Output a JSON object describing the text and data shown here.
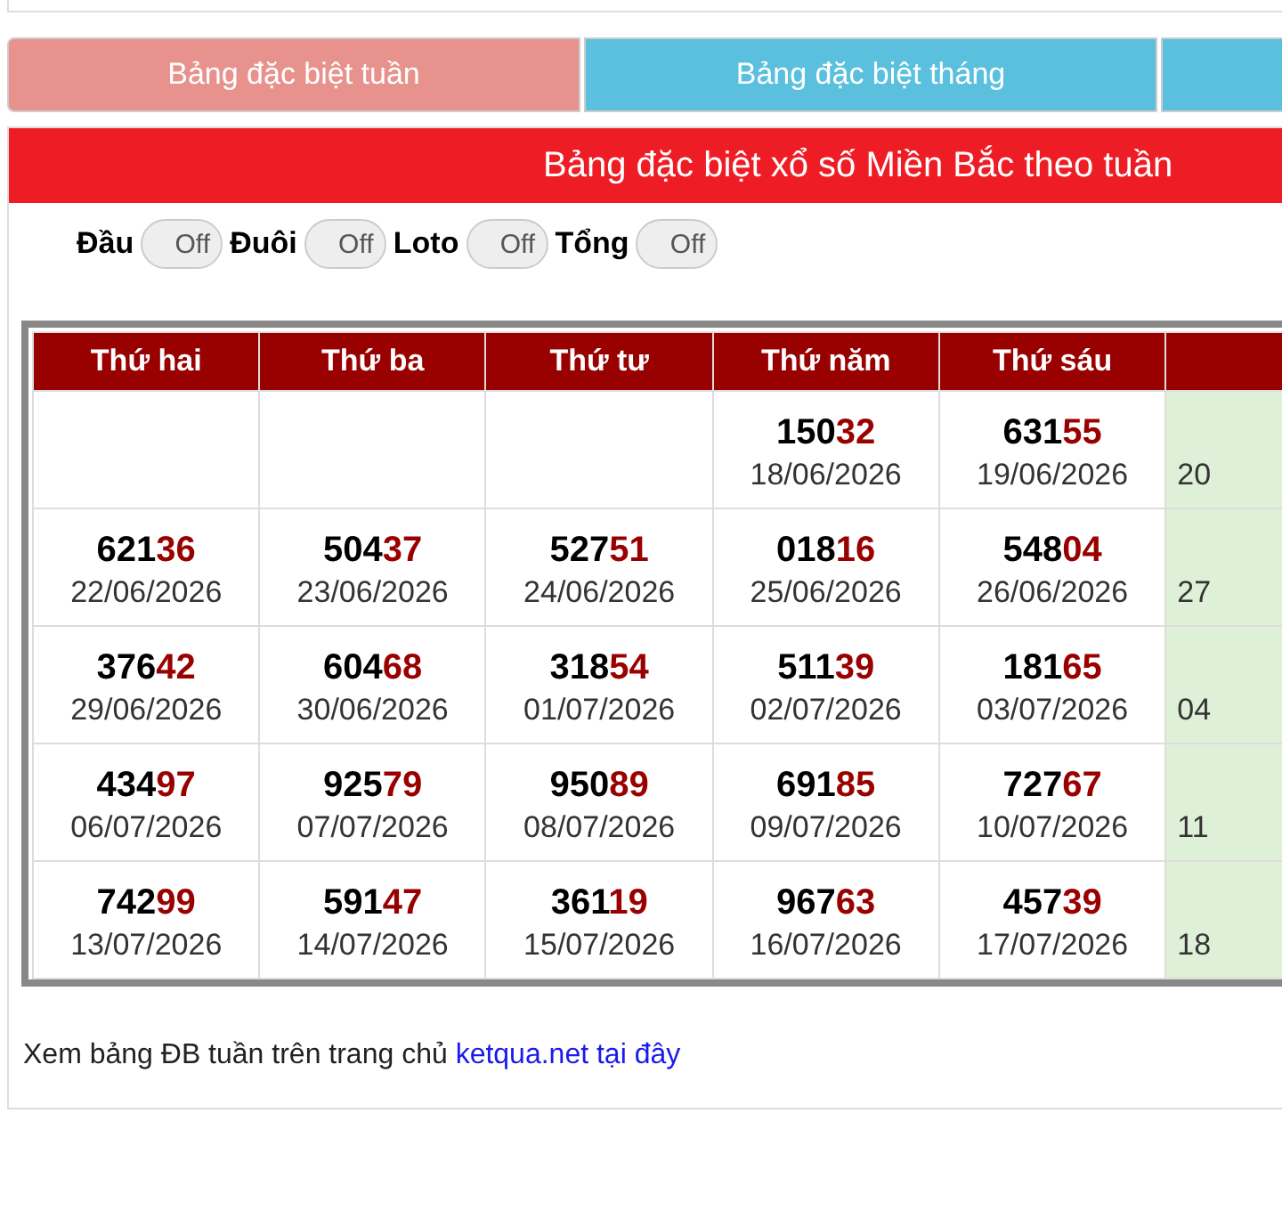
{
  "tabs": [
    {
      "label": "Bảng đặc biệt tuần",
      "selected": true
    },
    {
      "label": "Bảng đặc biệt tháng",
      "selected": false
    },
    {
      "selected": false
    }
  ],
  "title": "Bảng đặc biệt xổ số Miền Bắc theo tuần",
  "toggles": [
    {
      "label": "Đầu",
      "state": "Off",
      "on": false
    },
    {
      "label": "Đuôi",
      "state": "Off",
      "on": false
    },
    {
      "label": "Loto",
      "state": "Off",
      "on": false
    },
    {
      "label": "Tổng",
      "state": "Off",
      "on": false
    }
  ],
  "table": {
    "columns": [
      "Thứ hai",
      "Thứ ba",
      "Thứ tư",
      "Thứ năm",
      "Thứ sáu"
    ],
    "rows": [
      [
        {},
        {},
        {},
        {
          "number": "15032",
          "date": "18/06/2026"
        },
        {
          "number": "63155",
          "date": "19/06/2026"
        },
        {
          "date": "20"
        }
      ],
      [
        {
          "number": "62136",
          "date": "22/06/2026"
        },
        {
          "number": "50437",
          "date": "23/06/2026"
        },
        {
          "number": "52751",
          "date": "24/06/2026"
        },
        {
          "number": "01816",
          "date": "25/06/2026"
        },
        {
          "number": "54804",
          "date": "26/06/2026"
        },
        {
          "date": "27"
        }
      ],
      [
        {
          "number": "37642",
          "date": "29/06/2026"
        },
        {
          "number": "60468",
          "date": "30/06/2026"
        },
        {
          "number": "31854",
          "date": "01/07/2026"
        },
        {
          "number": "51139",
          "date": "02/07/2026"
        },
        {
          "number": "18165",
          "date": "03/07/2026"
        },
        {
          "date": "04"
        }
      ],
      [
        {
          "number": "43497",
          "date": "06/07/2026"
        },
        {
          "number": "92579",
          "date": "07/07/2026"
        },
        {
          "number": "95089",
          "date": "08/07/2026"
        },
        {
          "number": "69185",
          "date": "09/07/2026"
        },
        {
          "number": "72767",
          "date": "10/07/2026"
        },
        {
          "date": "11"
        }
      ],
      [
        {
          "number": "74299",
          "date": "13/07/2026"
        },
        {
          "number": "59147",
          "date": "14/07/2026"
        },
        {
          "number": "36119",
          "date": "15/07/2026"
        },
        {
          "number": "96763",
          "date": "16/07/2026"
        },
        {
          "number": "45739",
          "date": "17/07/2026"
        },
        {
          "date": "18"
        }
      ]
    ]
  },
  "footer": {
    "text": "Xem bảng ĐB tuần trên trang chủ",
    "link": "ketqua.net tại đây"
  }
}
